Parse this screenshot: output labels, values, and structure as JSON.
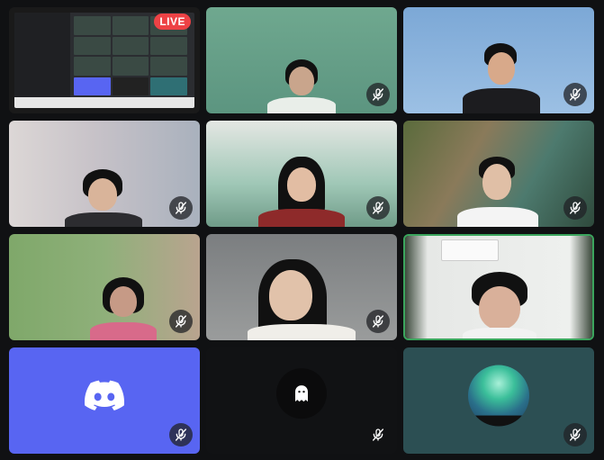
{
  "stream": {
    "live_label": "LIVE"
  },
  "colors": {
    "background": "#101113",
    "speaking_border": "#3ba55d",
    "discord_blurple": "#5865f2",
    "live_red": "#ed4245"
  },
  "tiles": [
    {
      "kind": "screen-share",
      "live": true
    },
    {
      "kind": "camera",
      "muted": true
    },
    {
      "kind": "camera",
      "muted": true
    },
    {
      "kind": "camera",
      "muted": true
    },
    {
      "kind": "camera",
      "muted": true
    },
    {
      "kind": "camera",
      "muted": true
    },
    {
      "kind": "camera",
      "muted": true
    },
    {
      "kind": "camera",
      "muted": true
    },
    {
      "kind": "camera",
      "muted": false,
      "speaking": true
    },
    {
      "kind": "avatar",
      "avatar": "discord-logo-icon",
      "muted": true
    },
    {
      "kind": "avatar",
      "avatar": "ghost-icon",
      "muted": true
    },
    {
      "kind": "avatar",
      "avatar": "aurora-avatar",
      "muted": true
    }
  ]
}
